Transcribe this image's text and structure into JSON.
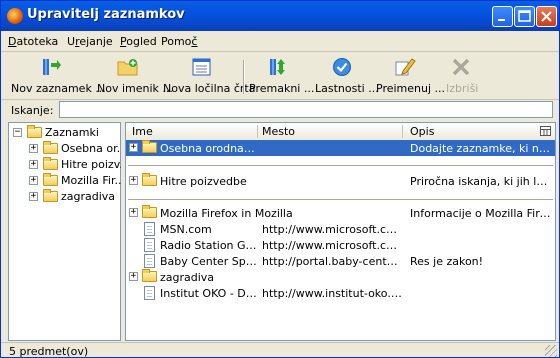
{
  "window": {
    "title": "Upravitelj zaznamkov"
  },
  "menu": [
    {
      "label": "Datoteka",
      "accel": "D"
    },
    {
      "label": "Urejanje",
      "accel": "r"
    },
    {
      "label": "Pogled",
      "accel": "P"
    },
    {
      "label": "Pomoč",
      "accel": "č"
    }
  ],
  "toolbar": {
    "new_bookmark": "Nov zaznamek ...",
    "new_folder": "Nov imenik ...",
    "new_separator": "Nova ločilna črta",
    "move": "Premakni ...",
    "properties": "Lastnosti ...",
    "rename": "Preimenuj ...",
    "delete": "Izbriši"
  },
  "search": {
    "label": "Iskanje:",
    "value": ""
  },
  "tree": {
    "root": "Zaznamki",
    "children": [
      "Osebna or...",
      "Hitre poizv...",
      "Mozilla Fir...",
      "zagradiva"
    ]
  },
  "list": {
    "columns": [
      "Ime",
      "Mesto",
      "Opis"
    ],
    "rows": [
      {
        "name": "Osebna orodna vrstica",
        "location": "",
        "description": "Dodajte zaznamke, ki naj se ..."
      },
      {
        "name": "Hitre poizvedbe",
        "location": "",
        "description": "Priročna iskanja, ki jih lahko i..."
      },
      {
        "name": "Mozilla Firefox in Mozilla",
        "location": "",
        "description": "Informacije o Mozilla Firefox..."
      },
      {
        "name": "MSN.com",
        "location": "http://www.microsoft.com/isa...",
        "description": ""
      },
      {
        "name": "Radio Station Guide",
        "location": "http://www.microsoft.com/isa...",
        "description": ""
      },
      {
        "name": "Baby Center Spletni ...",
        "location": "http://portal.baby-center.si/P...",
        "description": "Res je zakon!"
      },
      {
        "name": "zagradiva",
        "location": "",
        "description": ""
      },
      {
        "name": "Institut OKO - Domov",
        "location": "http://www.institut-oko.si/",
        "description": ""
      }
    ]
  },
  "status": {
    "text": "5 predmet(ov)"
  }
}
